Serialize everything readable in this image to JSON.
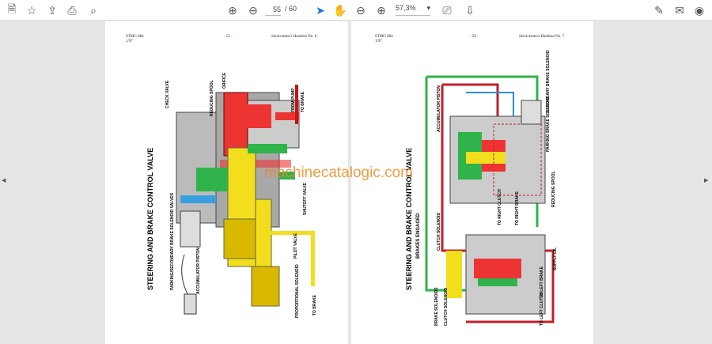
{
  "toolbar": {
    "icons": [
      "save-icon",
      "bookmark-star-icon",
      "upload-icon",
      "print-icon",
      "find-icon",
      "prev-page-icon",
      "next-page-icon",
      "select-cursor-icon",
      "hand-icon",
      "zoom-out-icon",
      "zoom-in-icon",
      "fit-page-icon",
      "scroll-mode-icon",
      "sign-icon",
      "mail-icon",
      "account-icon"
    ],
    "current_page": "55",
    "total_pages": "/ 60",
    "zoom": "57,3%",
    "accent": "#1a73e8"
  },
  "left_page": {
    "doc_id": "STMG 684",
    "date": "1/97",
    "page_num": "- 55 -",
    "handout": "Servicemen's Handout No. 6",
    "title": "STEERING AND BRAKE CONTROL VALVE",
    "labels": [
      "CHECK VALVE",
      "REDUCING SPOOL",
      "ORIFICE",
      "FROM PUMP",
      "TO BRAKE",
      "SHUTOFF VALVE",
      "PILOT VALVE",
      "PARKING/SECONDARY BRAKE SOLENOID VALVES",
      "ACCUMULATOR PISTON",
      "PROPORTIONAL SOLENOID",
      "TO BRAKE"
    ]
  },
  "right_page": {
    "doc_id": "STMG 684",
    "date": "1/97",
    "page_num": "- 56 -",
    "handout": "Servicemen's Handout No. 7",
    "title": "STEERING AND BRAKE CONTROL VALVE",
    "subtitle": "BRAKES ENGAGED",
    "labels": [
      "ACCUMULATOR PISTON",
      "SECONDARY BRAKE SOLENOID",
      "PARKING BRAKE SOLENOID",
      "REDUCING SPOOL",
      "TO RIGHT CLUTCH",
      "TO RIGHT BRAKE",
      "CLUTCH SOLENOID",
      "BRAKE SOLENOIDS",
      "CLUTCH SOLENOID",
      "SUPPLY OIL",
      "TO LEFT BRAKE",
      "TO LEFT CLUTCH"
    ]
  },
  "watermark": "machinecatalogic.com"
}
